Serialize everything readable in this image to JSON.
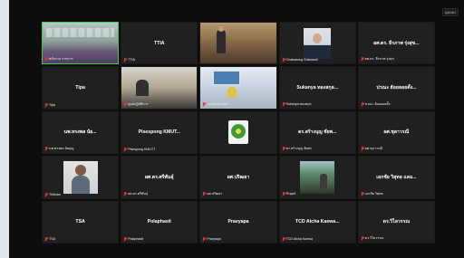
{
  "window": {
    "view_button": "มุมมอง"
  },
  "tiles": [
    {
      "kind": "video",
      "scene": "v-meeting",
      "name": "",
      "label": "พนักงาน ราชการ",
      "muted": true,
      "active": true
    },
    {
      "kind": "name",
      "name": "TTIA",
      "label": "TTIA",
      "muted": true
    },
    {
      "kind": "video",
      "scene": "v-presenter",
      "name": "",
      "label": "",
      "muted": false
    },
    {
      "kind": "video",
      "scene": "v-portrait",
      "name": "",
      "label": "Chainarong Sriswasdi",
      "muted": true
    },
    {
      "kind": "name",
      "name": "ผศ.ดร. ธีรภาพ รุ่งสุข...",
      "label": "ผศ.ดร. ธีรภาพ รุ่งสุข",
      "muted": true
    },
    {
      "kind": "name",
      "name": "Tipa",
      "label": "Tipa",
      "muted": true
    },
    {
      "kind": "video",
      "scene": "v-office",
      "name": "",
      "label": "ศูนย์ปฏิบัติการ",
      "muted": true
    },
    {
      "kind": "video",
      "scene": "v-classroom",
      "name": "",
      "label": "กองยุทธศาสตร์",
      "muted": true
    },
    {
      "kind": "name",
      "name": "Sukanya ทองสกุล...",
      "label": "Sukanya ทองสกุล",
      "muted": true
    },
    {
      "kind": "name",
      "name": "ปวณะ ฮ้อยลอยตั้ง...",
      "label": "ปวณะ ฮ้อยลอยตั้ง",
      "muted": true
    },
    {
      "kind": "name",
      "name": "นพ.ทรงพล นัย...",
      "label": "นพ.ทรงพล นัยบุญ",
      "muted": true
    },
    {
      "kind": "name",
      "name": "Pisespong KMUT...",
      "label": "Pisespong KMUTT",
      "muted": true
    },
    {
      "kind": "video",
      "scene": "v-logo",
      "name": "",
      "label": "",
      "muted": false
    },
    {
      "kind": "name",
      "name": "ดร.สร้างบุญ ชัยพ...",
      "label": "ดร.สร้างบุญ ชัยพร",
      "muted": true
    },
    {
      "kind": "name",
      "name": "ผศ.ชุลาวรณี",
      "label": "ผศ.ชุลาวรณี",
      "muted": true
    },
    {
      "kind": "video",
      "scene": "v-person",
      "name": "",
      "label": "Thitinan",
      "muted": true
    },
    {
      "kind": "name",
      "name": "ผศ.ดร.ศรีพันธุ์",
      "label": "ผศ.ดร.ศรีพันธุ์",
      "muted": true
    },
    {
      "kind": "name",
      "name": "ผศ.ปริฒยา",
      "label": "ผศ.ปริฒยา",
      "muted": true
    },
    {
      "kind": "video",
      "scene": "v-outdoor",
      "name": "",
      "label": "จีรยุทธ์",
      "muted": true
    },
    {
      "kind": "name",
      "name": "เอกชัย วิสุทธ แลม...",
      "label": "เอกชัย วิสุทธ",
      "muted": true
    },
    {
      "kind": "name",
      "name": "TSA",
      "label": "TSA",
      "muted": true
    },
    {
      "kind": "name",
      "name": "Polaphasit",
      "label": "Polaphasit",
      "muted": true
    },
    {
      "kind": "name",
      "name": "Praeyapa",
      "label": "Praeyapa",
      "muted": true
    },
    {
      "kind": "name",
      "name": "TCD Atcha Kaewa...",
      "label": "TCD Atcha Kaewa",
      "muted": true
    },
    {
      "kind": "name",
      "name": "ดร.วิไลวรรณ",
      "label": "ดร.วิไลวรรณ",
      "muted": true
    }
  ]
}
